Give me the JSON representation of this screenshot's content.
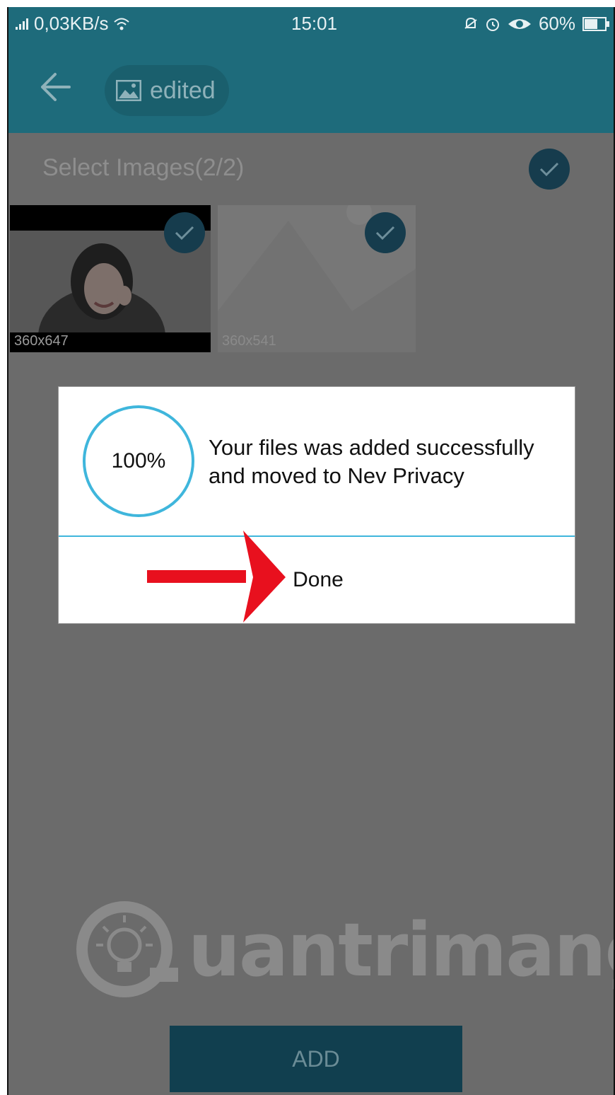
{
  "status_bar": {
    "network_speed": "0,03KB/s",
    "time": "15:01",
    "battery": "60%"
  },
  "toolbar": {
    "folder_label": "edited"
  },
  "selection": {
    "header": "Select Images(2/2)"
  },
  "images": [
    {
      "dimensions": "360x647",
      "selected": true
    },
    {
      "dimensions": "360x541",
      "selected": true
    }
  ],
  "dialog": {
    "progress": "100%",
    "message_line1": "Your files was added successfully",
    "message_line2": "and moved to Nev Privacy",
    "done_label": "Done"
  },
  "watermark": {
    "text": "uantrimang"
  },
  "add_button": {
    "label": "ADD"
  },
  "colors": {
    "toolbar": "#1e6b7b",
    "overlay": "#6b6b6b",
    "accent": "#3fb6dc",
    "check": "#163c4d",
    "arrow": "#e8101e"
  }
}
